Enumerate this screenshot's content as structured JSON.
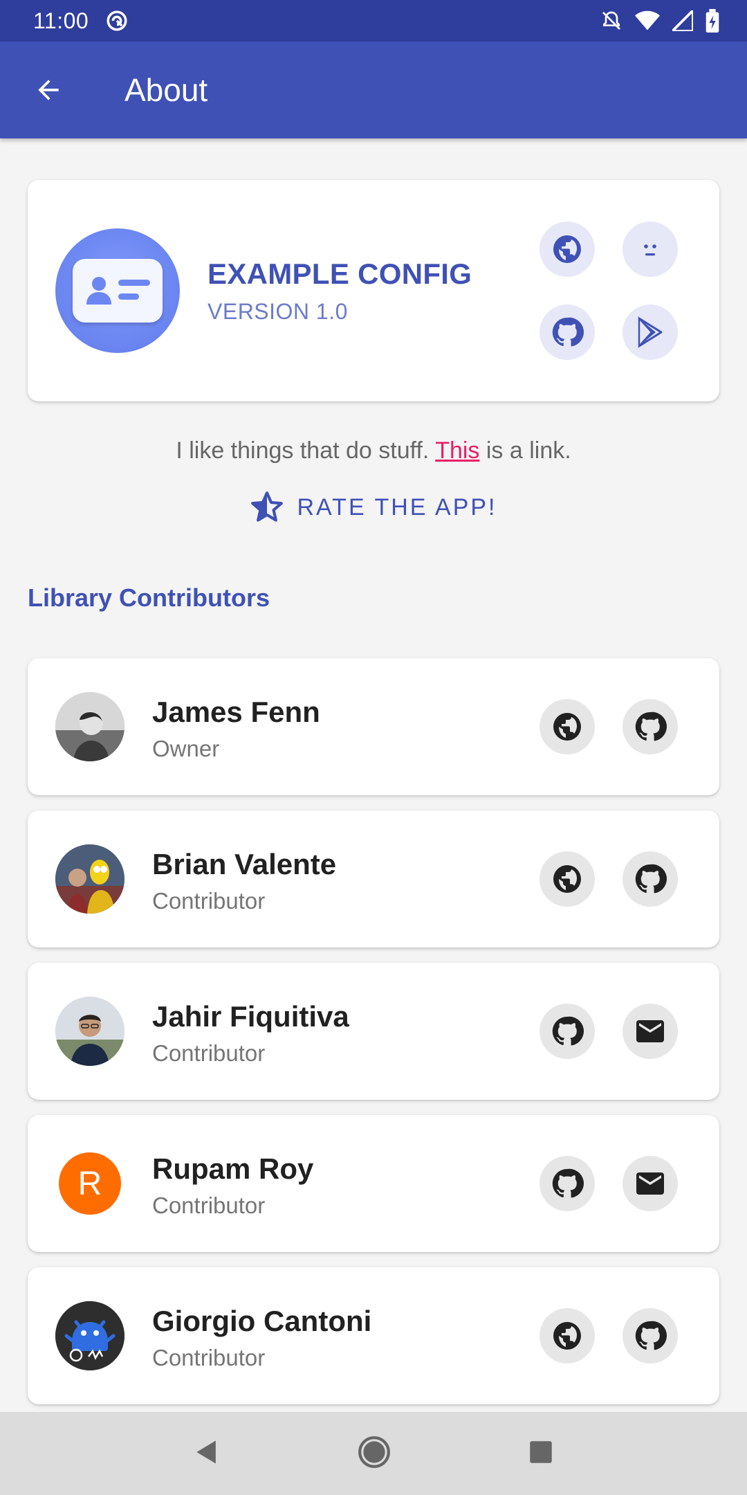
{
  "status_bar": {
    "time": "11:00"
  },
  "app_bar": {
    "title": "About"
  },
  "header": {
    "app_name": "EXAMPLE CONFIG",
    "version": "VERSION 1.0",
    "accent_color": "#3f51b5"
  },
  "description": {
    "before": "I like things that do stuff. ",
    "link": "This",
    "after": " is a link."
  },
  "rate_label": "RATE THE APP!",
  "section_title": "Library Contributors",
  "contributors": [
    {
      "name": "James Fenn",
      "role": "Owner",
      "actions": [
        "globe-icon",
        "github-icon"
      ]
    },
    {
      "name": "Brian Valente",
      "role": "Contributor",
      "actions": [
        "globe-icon",
        "github-icon"
      ]
    },
    {
      "name": "Jahir Fiquitiva",
      "role": "Contributor",
      "actions": [
        "github-icon",
        "email-icon"
      ]
    },
    {
      "name": "Rupam Roy",
      "role": "Contributor",
      "avatar_letter": "R",
      "avatar_color": "#ff6d00",
      "actions": [
        "github-icon",
        "email-icon"
      ]
    },
    {
      "name": "Giorgio Cantoni",
      "role": "Contributor",
      "actions": [
        "globe-icon",
        "github-icon"
      ]
    }
  ]
}
